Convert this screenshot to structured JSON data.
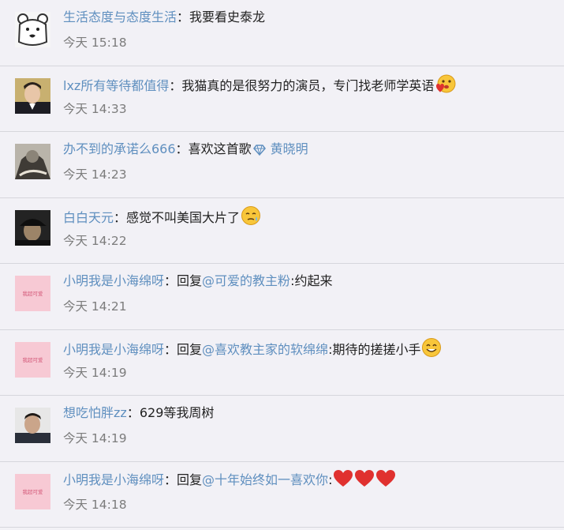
{
  "colon": "：",
  "comments": [
    {
      "user": "生活态度与态度生活",
      "before": "",
      "mention": "",
      "text": "我要看史泰龙",
      "tag": "",
      "time": "今天 15:18"
    },
    {
      "user": "lxz所有等待都值得",
      "before": "",
      "mention": "",
      "text": "我猫真的是很努力的演员，专门找老师学英语",
      "tag": "",
      "time": "今天 14:33"
    },
    {
      "user": "办不到的承诺么666",
      "before": "",
      "mention": "",
      "text": "喜欢这首歌",
      "tag": "黄晓明",
      "time": "今天 14:23"
    },
    {
      "user": "白白天元",
      "before": "",
      "mention": "",
      "text": "感觉不叫美国大片了",
      "tag": "",
      "time": "今天 14:22"
    },
    {
      "user": "小明我是小海绵呀",
      "before": "回复",
      "mention": "@可爱的教主粉",
      "text": ":约起来",
      "tag": "",
      "time": "今天 14:21"
    },
    {
      "user": "小明我是小海绵呀",
      "before": "回复",
      "mention": "@喜欢教主家的软绵绵",
      "text": ":期待的搓搓小手",
      "tag": "",
      "time": "今天 14:19"
    },
    {
      "user": "想吃怕胖zz",
      "before": "",
      "mention": "",
      "text": "629等我周树",
      "tag": "",
      "time": "今天 14:19"
    },
    {
      "user": "小明我是小海绵呀",
      "before": "回复",
      "mention": "@十年始终如一喜欢你",
      "text": ":",
      "tag": "",
      "time": "今天 14:18"
    }
  ],
  "avatar_text": "我超可爱",
  "icons": [
    "bear-avatar",
    "man-avatar",
    "cat-avatar",
    "cap-avatar",
    "pink-text-avatar",
    "man-avatar",
    "heart-icon",
    "diamond-icon",
    "smile-emoji-icon",
    "tongue-emoji-icon"
  ],
  "colors": {
    "link": "#5f8fbf",
    "text": "#222222",
    "time": "#7c7c7c",
    "background": "#f2f1f6",
    "heart": "#e0312f"
  }
}
